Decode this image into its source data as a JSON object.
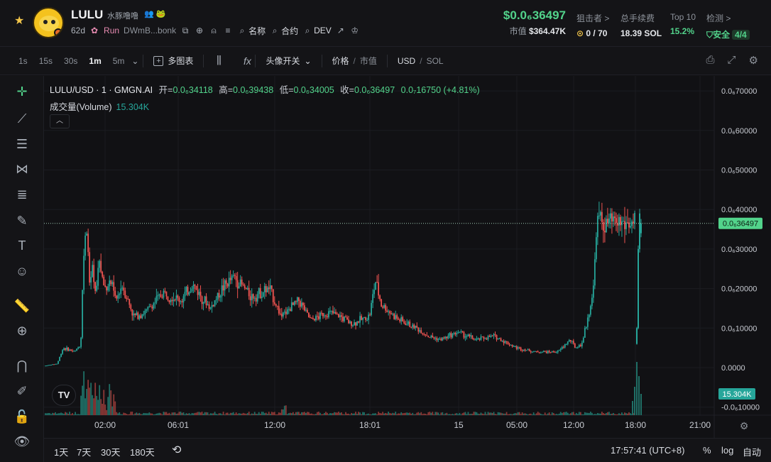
{
  "token": {
    "name": "LULU",
    "subtitle": "水豚噜噜",
    "age": "62d",
    "status": "Run",
    "address": "DWmB...bonk",
    "links": [
      "名称",
      "合约",
      "DEV"
    ]
  },
  "price": {
    "value": "$0.0₆36497",
    "mcap_label": "市值",
    "mcap_value": "$364.47K"
  },
  "stats": {
    "snipers": {
      "label": "狙击者 >",
      "value": "0 / 70"
    },
    "fees": {
      "label": "总手续费",
      "value": "18.39 SOL"
    },
    "top10": {
      "label": "Top 10",
      "value": "15.2%"
    },
    "check": {
      "label": "检测 >",
      "value": "安全",
      "badge": "4/4"
    }
  },
  "toolbar": {
    "timeframes": [
      "1s",
      "15s",
      "30s",
      "1m",
      "5m"
    ],
    "active_timeframe": "1m",
    "multi_chart": "多图表",
    "header_toggle": "头像开关",
    "price_toggle": "价格",
    "mcap_toggle": "市值",
    "currency_a": "USD",
    "currency_b": "SOL"
  },
  "legend": {
    "title": "LULU/USD · 1 · GMGN.AI",
    "open_label": "开=",
    "open": "0.0₆34118",
    "high_label": "高=",
    "high": "0.0₆39438",
    "low_label": "低=",
    "low": "0.0₆34005",
    "close_label": "收=",
    "close": "0.0₆36497",
    "change": "0.0₇16750 (+4.81%)",
    "volume_label": "成交量(Volume)",
    "volume": "15.304K"
  },
  "chart_data": {
    "type": "candlestick",
    "y_axis": {
      "ticks": [
        "0.0₆70000",
        "0.0₆60000",
        "0.0₆50000",
        "0.0₆40000",
        "0.0₆30000",
        "0.0₆20000",
        "0.0₆10000",
        "0.0000",
        "-0.0₆10000"
      ],
      "tick_values": [
        7e-07,
        6e-07,
        5e-07,
        4e-07,
        3e-07,
        2e-07,
        1e-07,
        0,
        -1e-07
      ]
    },
    "x_axis": {
      "ticks": [
        "02:00",
        "06:01",
        "12:00",
        "18:01",
        "15",
        "05:00",
        "12:00",
        "18:00",
        "21:00"
      ]
    },
    "last_price_label": "0.0₆36497",
    "last_price": 3.6497e-07,
    "volume_label": "15.304K",
    "price_path": [
      [
        0.0,
        5e-09
      ],
      [
        0.02,
        1e-08
      ],
      [
        0.03,
        5e-08
      ],
      [
        0.05,
        4e-08
      ],
      [
        0.06,
        6e-08
      ],
      [
        0.065,
        3e-07
      ],
      [
        0.07,
        3.5e-07
      ],
      [
        0.075,
        2e-07
      ],
      [
        0.08,
        2.5e-07
      ],
      [
        0.085,
        1.8e-07
      ],
      [
        0.09,
        2.8e-07
      ],
      [
        0.1,
        2e-07
      ],
      [
        0.11,
        2.2e-07
      ],
      [
        0.12,
        1.7e-07
      ],
      [
        0.13,
        2.1e-07
      ],
      [
        0.15,
        1.3e-07
      ],
      [
        0.17,
        1.4e-07
      ],
      [
        0.2,
        1.9e-07
      ],
      [
        0.23,
        1.7e-07
      ],
      [
        0.25,
        2.1e-07
      ],
      [
        0.28,
        1.5e-07
      ],
      [
        0.3,
        2e-07
      ],
      [
        0.32,
        2.3e-07
      ],
      [
        0.35,
        1.8e-07
      ],
      [
        0.38,
        2e-07
      ],
      [
        0.4,
        1.3e-07
      ],
      [
        0.43,
        1.7e-07
      ],
      [
        0.45,
        1.2e-07
      ],
      [
        0.48,
        1.4e-07
      ],
      [
        0.5,
        1.3e-07
      ],
      [
        0.52,
        1.1e-07
      ],
      [
        0.55,
        1.3e-07
      ],
      [
        0.56,
        2.2e-07
      ],
      [
        0.57,
        1.6e-07
      ],
      [
        0.6,
        1.2e-07
      ],
      [
        0.63,
        1e-07
      ],
      [
        0.65,
        8e-08
      ],
      [
        0.67,
        7e-08
      ],
      [
        0.7,
        9e-08
      ],
      [
        0.73,
        7e-08
      ],
      [
        0.76,
        8e-08
      ],
      [
        0.8,
        5e-08
      ],
      [
        0.83,
        4e-08
      ],
      [
        0.87,
        4e-08
      ],
      [
        0.89,
        7e-08
      ],
      [
        0.9,
        5e-08
      ],
      [
        0.91,
        6e-08
      ],
      [
        0.92,
        1.2e-07
      ],
      [
        0.93,
        2e-07
      ],
      [
        0.935,
        3.5e-07
      ],
      [
        0.94,
        3.8e-07
      ],
      [
        0.945,
        3.6497e-07
      ]
    ]
  },
  "bottom": {
    "ranges": [
      "1天",
      "7天",
      "30天",
      "180天"
    ],
    "clock": "17:57:41 (UTC+8)",
    "percent": "%",
    "log": "log",
    "auto": "自动"
  },
  "colors": {
    "up": "#26a69a",
    "down": "#ef5350",
    "price_green": "#52d38b",
    "background": "#111114"
  }
}
